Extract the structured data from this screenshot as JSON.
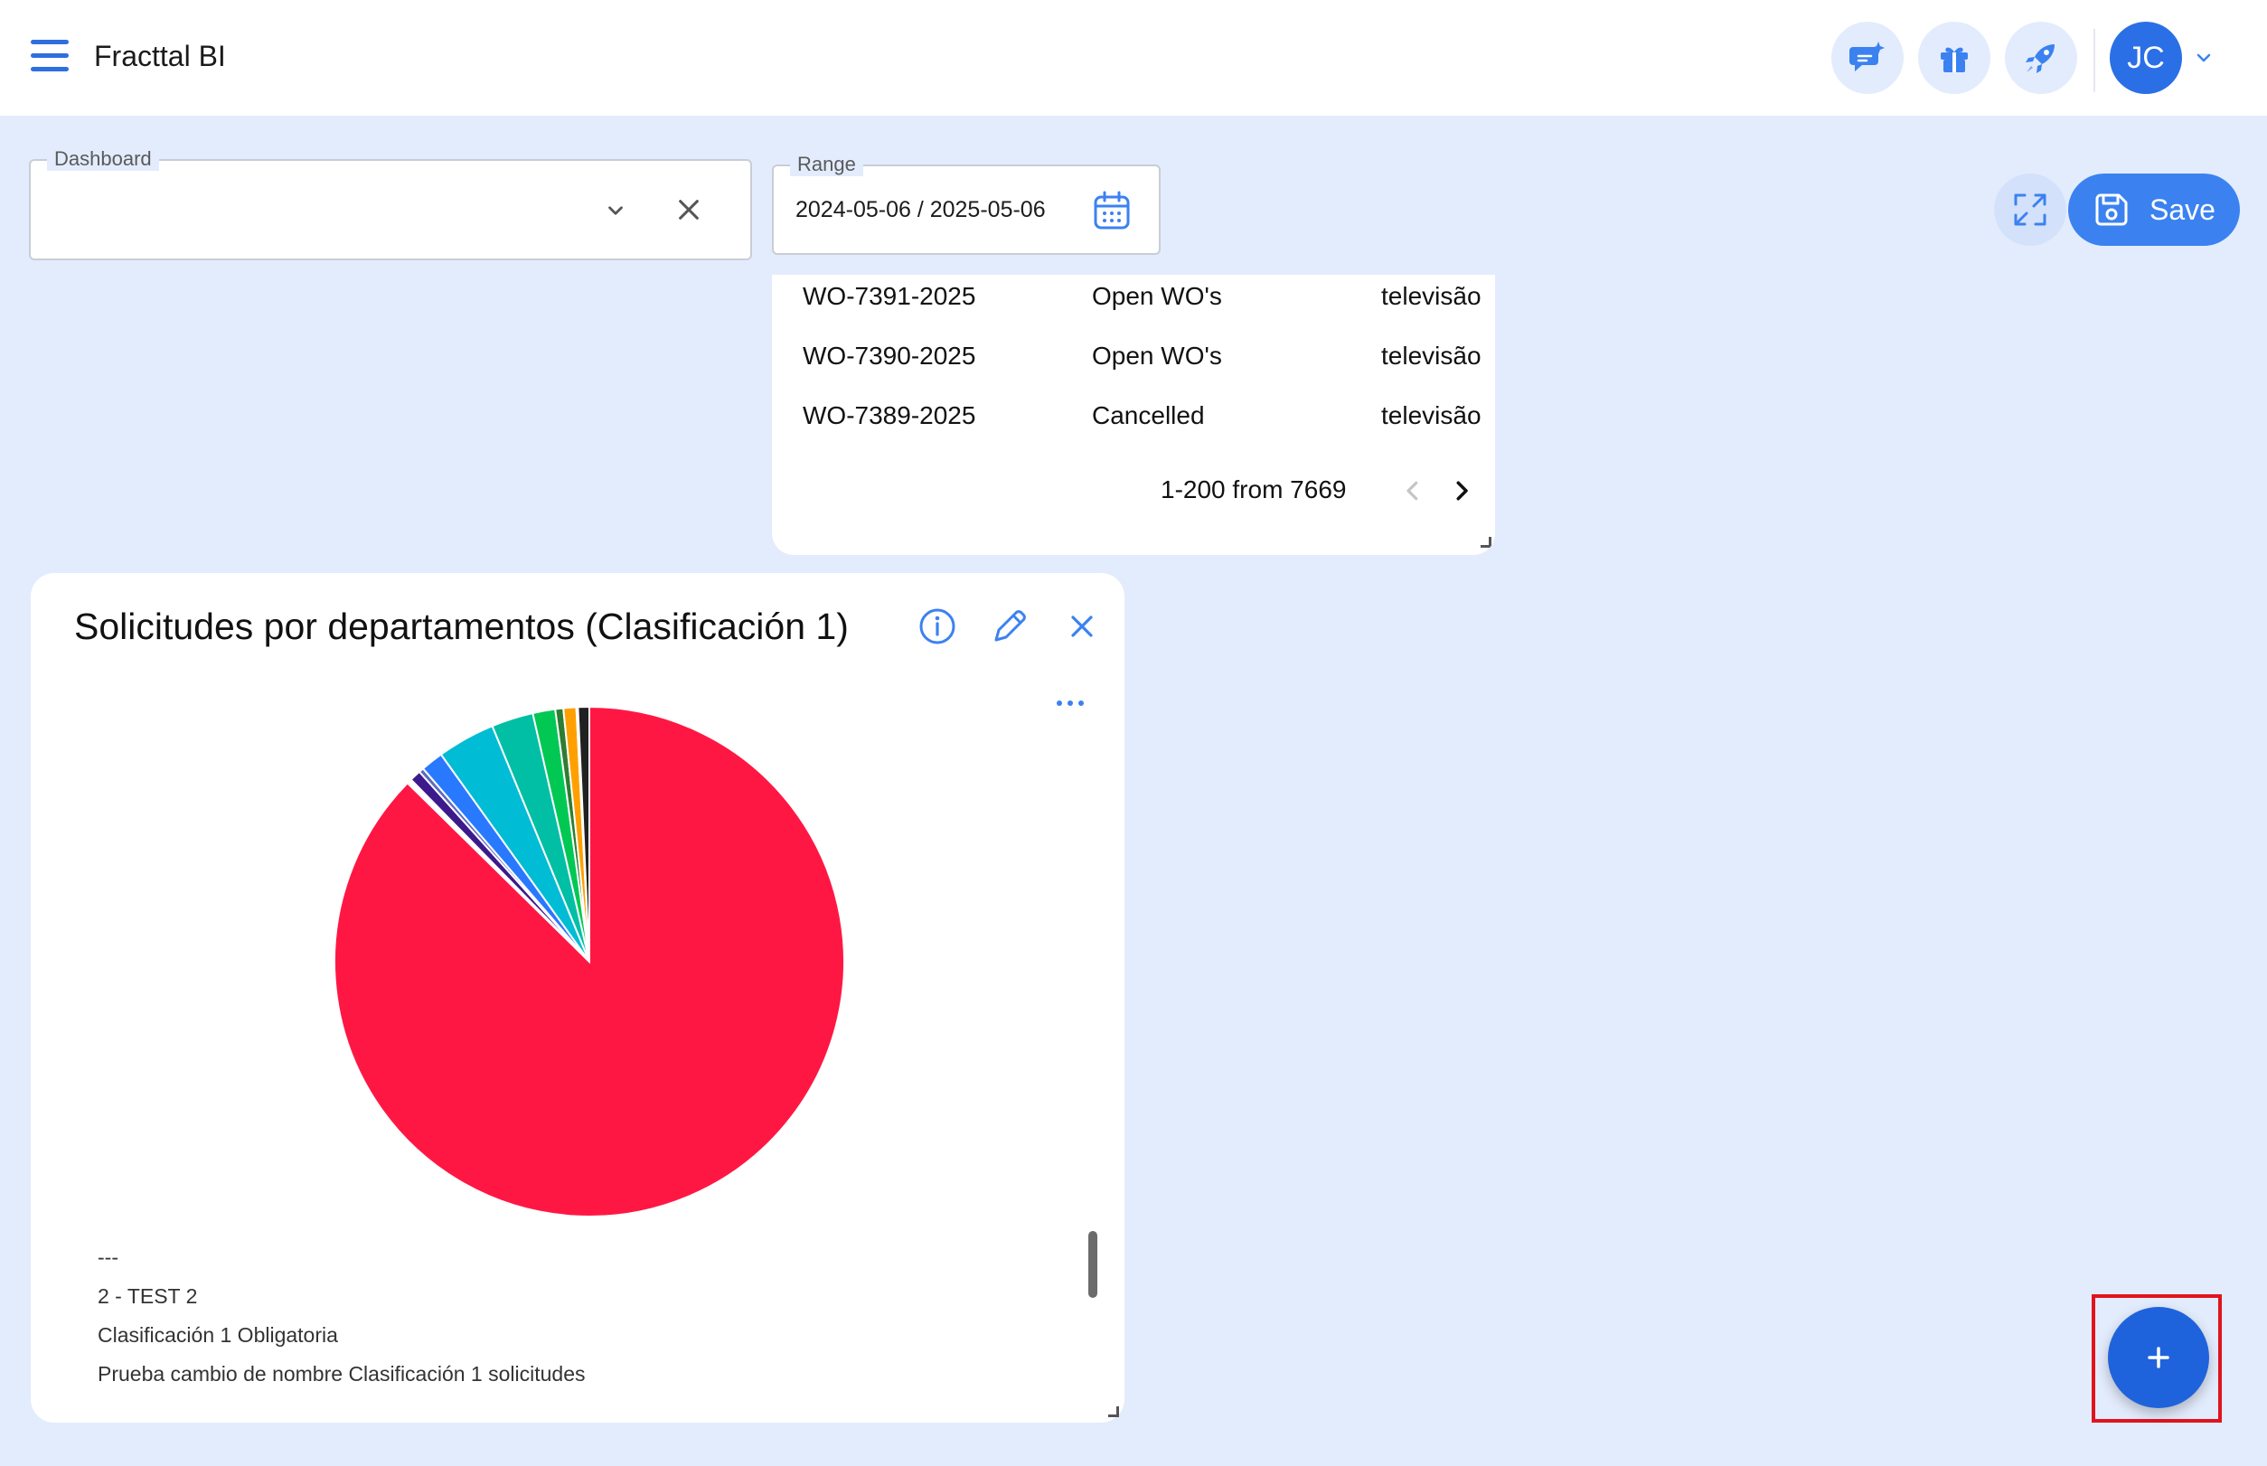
{
  "app": {
    "title": "Fracttal BI"
  },
  "header": {
    "icons": [
      "chat-sparkle-icon",
      "gift-icon",
      "rocket-icon"
    ],
    "avatar_initials": "JC"
  },
  "filters": {
    "dashboard_label": "Dashboard",
    "dashboard_value": "",
    "range_label": "Range",
    "range_value": "2024-05-06 / 2025-05-06"
  },
  "toolbar": {
    "save_label": "Save"
  },
  "table": {
    "rows": [
      {
        "code": "WO-7391-2025",
        "status": "Open WO's",
        "asset": "televisão"
      },
      {
        "code": "WO-7390-2025",
        "status": "Open WO's",
        "asset": "televisão"
      },
      {
        "code": "WO-7389-2025",
        "status": "Cancelled",
        "asset": "televisão"
      }
    ],
    "pagination": "1-200 from 7669"
  },
  "chart_card": {
    "title": "Solicitudes por departamentos (Clasificación 1)",
    "legend": [
      "---",
      "2 - TEST 2",
      "Clasificación 1 Obligatoria",
      "Prueba cambio de nombre Clasificación 1 solicitudes"
    ]
  },
  "chart_data": {
    "type": "pie",
    "title": "Solicitudes por departamentos (Clasificación 1)",
    "slices": [
      {
        "value": 85.7,
        "color": "#ff1744"
      },
      {
        "value": 0.3,
        "color": "#ffffff"
      },
      {
        "value": 0.7,
        "color": "#3d1a8c"
      },
      {
        "value": 0.3,
        "color": "#5c6bc0"
      },
      {
        "value": 1.4,
        "color": "#2979ff"
      },
      {
        "value": 3.6,
        "color": "#00bcd4"
      },
      {
        "value": 2.6,
        "color": "#00bfa5"
      },
      {
        "value": 1.4,
        "color": "#00c853"
      },
      {
        "value": 0.5,
        "color": "#2e7d32"
      },
      {
        "value": 0.8,
        "color": "#ffa000"
      },
      {
        "value": 0.1,
        "color": "#616161"
      },
      {
        "value": 0.7,
        "color": "#212121"
      }
    ]
  },
  "colors": {
    "accent": "#3b82f0",
    "background": "#e3ecfd",
    "fab": "#1f63dc",
    "highlight": "#e0141e"
  }
}
